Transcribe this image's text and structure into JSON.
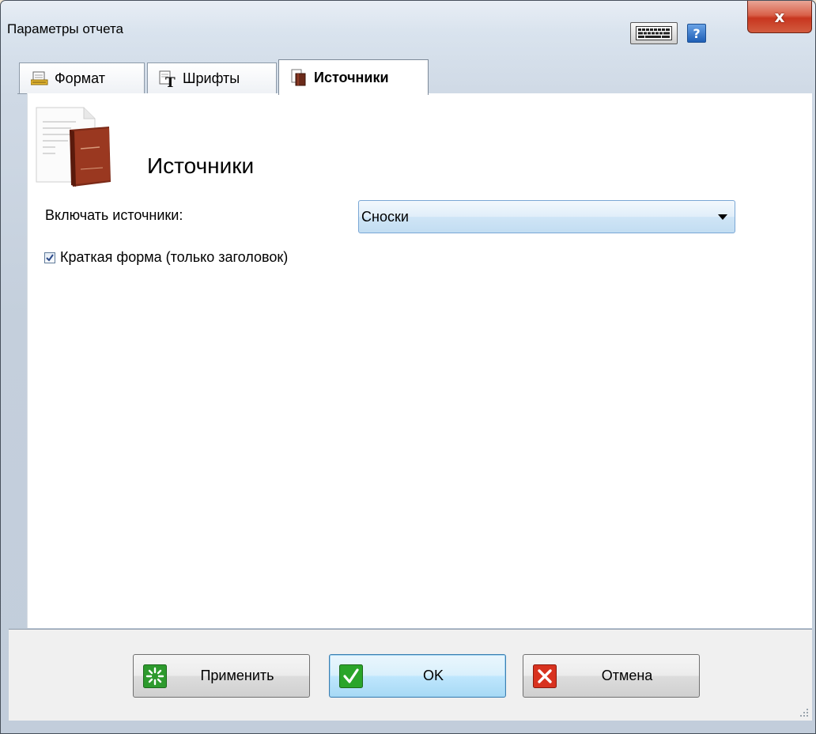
{
  "window": {
    "title": "Параметры отчета",
    "close_glyph": "x",
    "help_glyph": "?"
  },
  "tabs": [
    {
      "label": "Формат",
      "icon": "format-icon",
      "active": false
    },
    {
      "label": "Шрифты",
      "icon": "font-icon",
      "active": false
    },
    {
      "label": "Источники",
      "icon": "sources-icon",
      "active": true
    }
  ],
  "panel": {
    "section_title": "Источники",
    "include_label": "Включать источники:",
    "include_value": "Сноски",
    "short_form_label": "Краткая форма (только заголовок)",
    "short_form_checked": true
  },
  "buttons": {
    "apply": "Применить",
    "ok": "OK",
    "cancel": "Отмена"
  },
  "colors": {
    "close": "#c8361f",
    "help": "#1f5fb6",
    "apply_icon": "#2d9a2d",
    "ok_icon": "#2aa52a",
    "cancel_icon": "#d8321f"
  }
}
